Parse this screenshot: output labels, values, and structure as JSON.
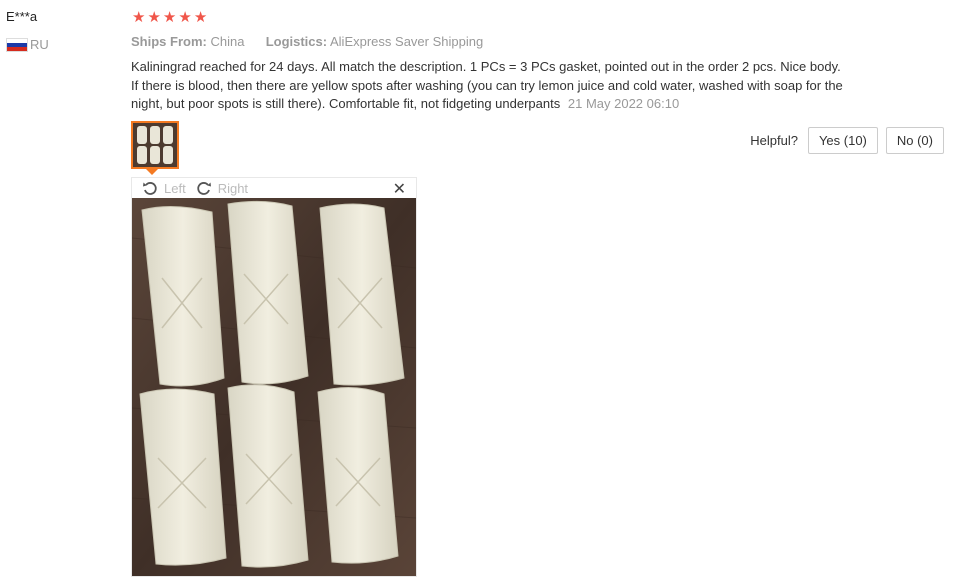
{
  "review": {
    "user_name": "E***a",
    "country_code": "RU",
    "rating_stars": 5,
    "ships_from_label": "Ships From:",
    "ships_from_value": "China",
    "logistics_label": "Logistics:",
    "logistics_value": "AliExpress Saver Shipping",
    "text": "Kaliningrad reached for 24 days. All match the description. 1 PCs = 3 PCs gasket, pointed out in the order 2 pcs. Nice body. If there is blood, then there are yellow spots after washing (you can try lemon juice and cold water, washed with soap for the night, but poor spots is still there). Comfortable fit, not fidgeting underpants",
    "date": "21 May 2022 06:10"
  },
  "helpful": {
    "label": "Helpful?",
    "yes_label": "Yes (10)",
    "no_label": "No (0)"
  },
  "viewer": {
    "rotate_left_label": "Left",
    "rotate_right_label": "Right",
    "close_glyph": "✕"
  },
  "colors": {
    "star": "#f0564a",
    "thumb_border": "#f47a22",
    "muted_text": "#999999"
  }
}
